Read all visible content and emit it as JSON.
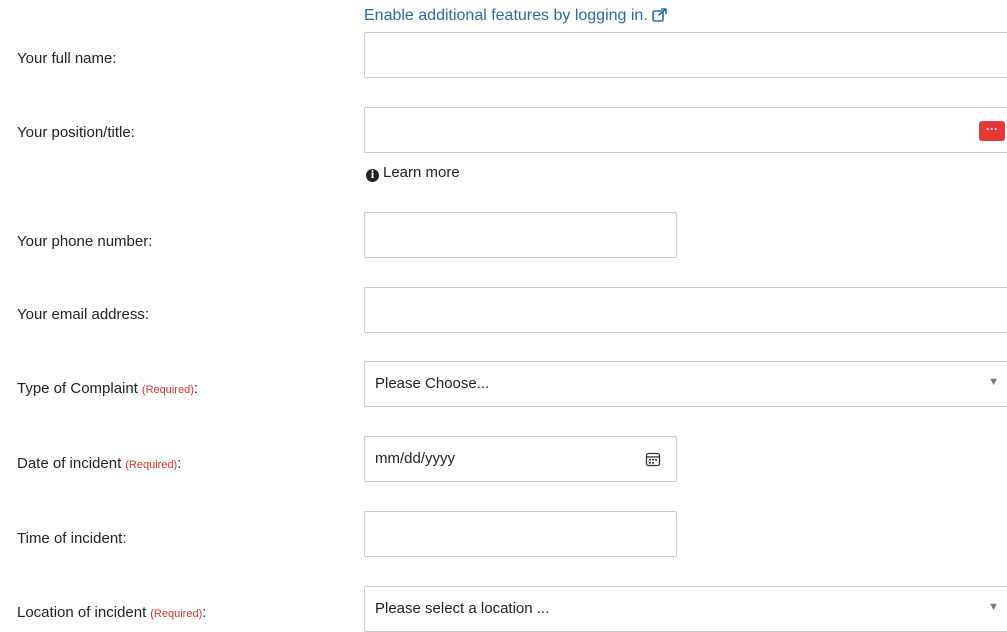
{
  "login_link": {
    "text": "Enable additional features by logging in.",
    "icon": "external-link-icon"
  },
  "required_text": "(Required)",
  "fields": {
    "full_name": {
      "label": "Your full name:",
      "value": ""
    },
    "position": {
      "label": "Your position/title:",
      "value": "",
      "learn_more": "Learn more"
    },
    "phone": {
      "label": "Your phone number:",
      "value": ""
    },
    "email": {
      "label": "Your email address:",
      "value": ""
    },
    "complaint_type": {
      "label": "Type of Complaint",
      "selected": "Please Choose..."
    },
    "incident_date": {
      "label": "Date of incident",
      "placeholder": "mm/dd/yyyy"
    },
    "incident_time": {
      "label": "Time of incident:",
      "value": ""
    },
    "incident_location": {
      "label": "Location of incident",
      "selected": "Please select a location ..."
    }
  },
  "colors": {
    "link": "#2a6aa8",
    "required": "#d0352b",
    "password_manager_badge": "#e53935"
  }
}
